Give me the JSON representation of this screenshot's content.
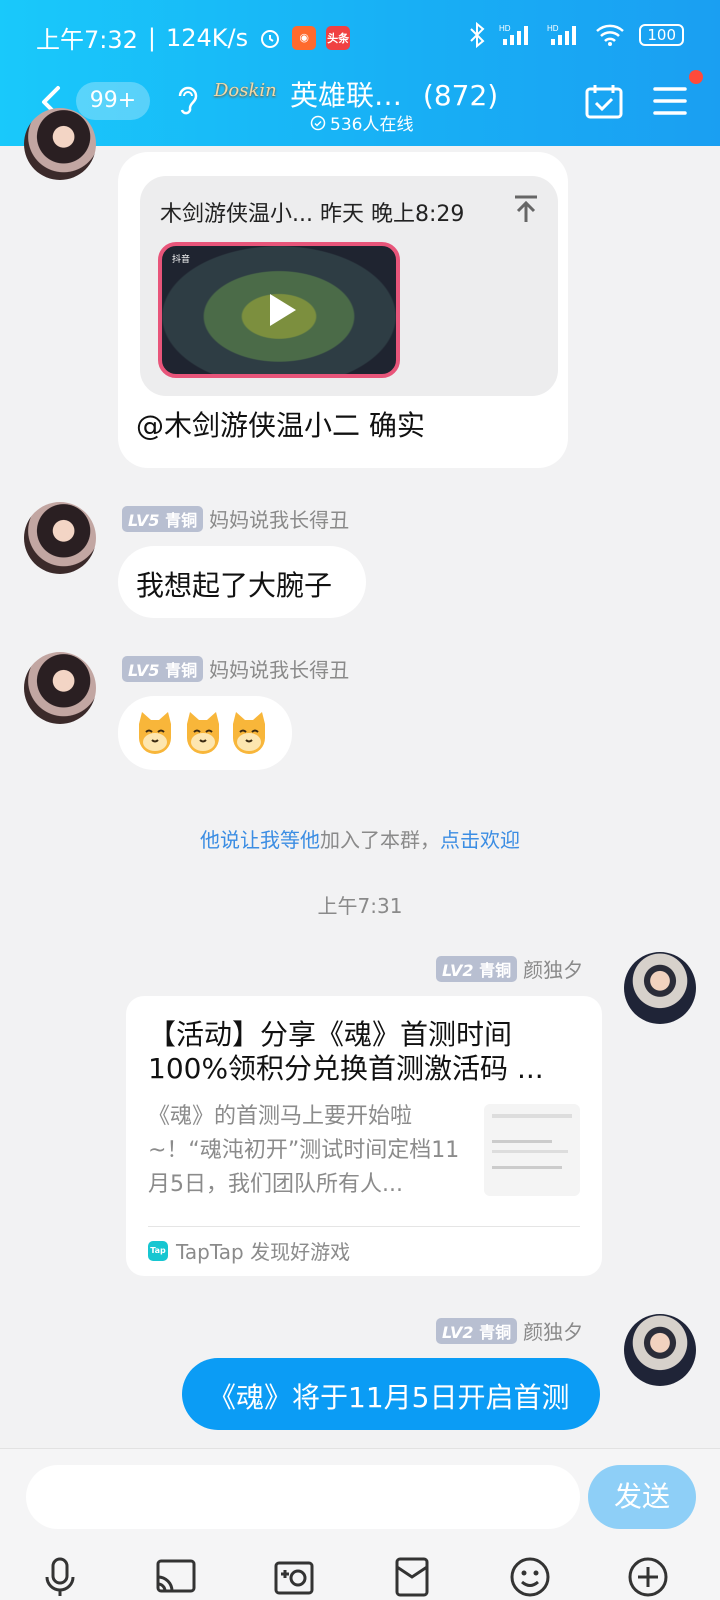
{
  "status_bar": {
    "time": "上午7:32",
    "speed": "124K/s",
    "battery": "100",
    "app_icon_news": "头条"
  },
  "header": {
    "unread_badge": "99+",
    "logo_text": "Doskin",
    "group_title": "英雄联…",
    "member_count": "(872)",
    "online_text": "536人在线"
  },
  "messages": {
    "reply": {
      "quote_header": "木剑游侠温小... 昨天 晚上8:29",
      "video_brand": "抖音",
      "text": "@木剑游侠温小二 确实"
    },
    "msg2": {
      "level": "LV5",
      "rank": "青铜",
      "sender": "妈妈说我长得丑",
      "text": "我想起了大腕子"
    },
    "msg3": {
      "level": "LV5",
      "rank": "青铜",
      "sender": "妈妈说我长得丑",
      "emoji": [
        "🐱",
        "🐱",
        "🐱"
      ]
    },
    "system_join": {
      "user": "他说让我等他",
      "middle": "加入了本群，",
      "action": "点击欢迎"
    },
    "timestamp": "上午7:31",
    "msg4": {
      "level": "LV2",
      "rank": "青铜",
      "sender": "颜独夕",
      "card_title": "【活动】分享《魂》首测时间100%领积分兑换首测激活码 ...",
      "card_desc": "《魂》的首测马上要开始啦~！“魂沌初开”测试时间定档11月5日，我们团队所有人...",
      "card_icon_text": "Tap",
      "card_source": "TapTap 发现好游戏"
    },
    "msg5": {
      "level": "LV2",
      "rank": "青铜",
      "sender": "颜独夕",
      "text": "《魂》将于11月5日开启首测"
    }
  },
  "input": {
    "send_label": "发送"
  },
  "colors": {
    "header_start": "#19c9fb",
    "header_end": "#1a9ff2",
    "my_bubble": "#0b9cf5",
    "link": "#3b8de3",
    "send_button": "#8ecff7"
  }
}
